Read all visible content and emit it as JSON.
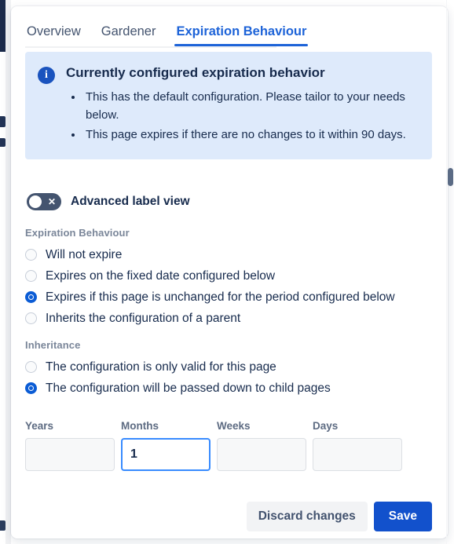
{
  "tabs": [
    {
      "label": "Overview",
      "active": false
    },
    {
      "label": "Gardener",
      "active": false
    },
    {
      "label": "Expiration Behaviour",
      "active": true
    }
  ],
  "banner": {
    "icon": "info-icon",
    "title": "Currently configured expiration behavior",
    "items": [
      "This has the default configuration. Please tailor to your needs below.",
      "This page expires if there are no changes to it within 90 days."
    ],
    "background_color": "#deeafb",
    "icon_color": "#1a53be"
  },
  "advanced_toggle": {
    "label": "Advanced label view",
    "state": "off",
    "mark": "✕",
    "track_color": "#44546f"
  },
  "expiration_behaviour": {
    "group_label": "Expiration Behaviour",
    "options": [
      {
        "label": "Will not expire",
        "selected": false
      },
      {
        "label": "Expires on the fixed date configured below",
        "selected": false
      },
      {
        "label": "Expires if this page is unchanged for the period configured below",
        "selected": true
      },
      {
        "label": "Inherits the configuration of a parent",
        "selected": false
      }
    ]
  },
  "inheritance": {
    "group_label": "Inheritance",
    "options": [
      {
        "label": "The configuration is only valid for this page",
        "selected": false
      },
      {
        "label": "The configuration will be passed down to child pages",
        "selected": true
      }
    ]
  },
  "duration": {
    "fields": [
      {
        "label": "Years",
        "value": "",
        "focused": false
      },
      {
        "label": "Months",
        "value": "1",
        "focused": true
      },
      {
        "label": "Weeks",
        "value": "",
        "focused": false
      },
      {
        "label": "Days",
        "value": "",
        "focused": false
      }
    ]
  },
  "footer": {
    "discard_label": "Discard changes",
    "save_label": "Save",
    "save_color": "#1251cc"
  },
  "colors": {
    "accent": "#1d63d8",
    "radio_selected": "#0b5cd5",
    "text": "#172b4d",
    "muted_text": "#7a8699"
  }
}
